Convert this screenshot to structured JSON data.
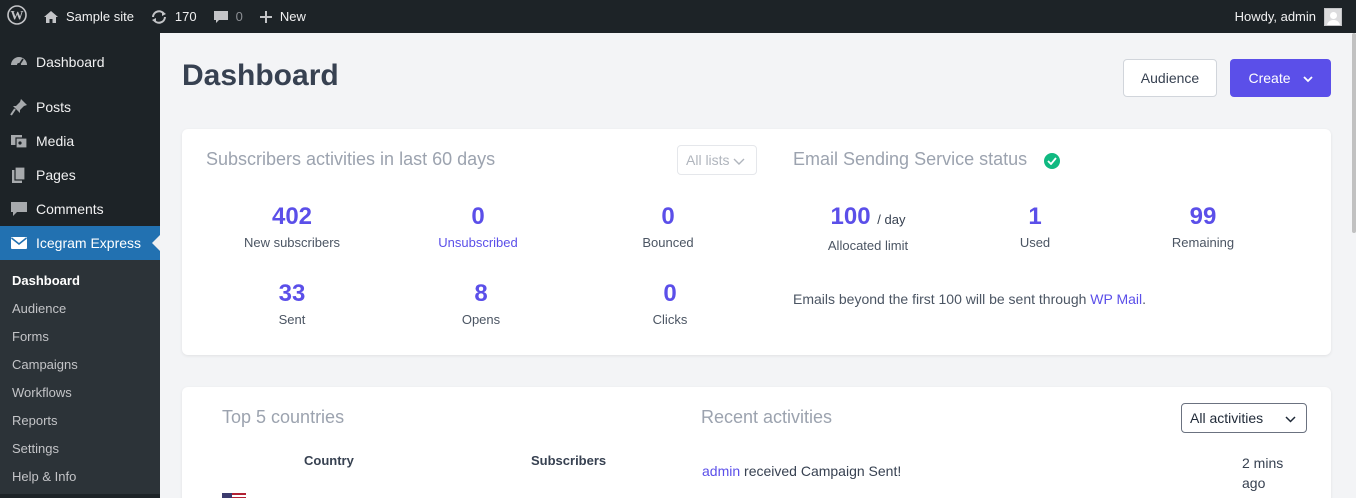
{
  "adminbar": {
    "site_name": "Sample site",
    "updates_count": "170",
    "comments_count": "0",
    "new_label": "New",
    "greeting": "Howdy, admin"
  },
  "sidebar": {
    "items": [
      {
        "label": "Dashboard",
        "icon": "dashboard-icon"
      },
      {
        "label": "Posts",
        "icon": "pin-icon"
      },
      {
        "label": "Media",
        "icon": "media-icon"
      },
      {
        "label": "Pages",
        "icon": "pages-icon"
      },
      {
        "label": "Comments",
        "icon": "comment-icon"
      },
      {
        "label": "Icegram Express",
        "icon": "email-icon"
      }
    ],
    "submenu": [
      "Dashboard",
      "Audience",
      "Forms",
      "Campaigns",
      "Workflows",
      "Reports",
      "Settings",
      "Help & Info"
    ]
  },
  "page": {
    "title": "Dashboard",
    "audience_button": "Audience",
    "create_button": "Create"
  },
  "subscribers": {
    "title": "Subscribers activities in last 60 days",
    "filter": "All lists",
    "stats": [
      {
        "value": "402",
        "label": "New subscribers"
      },
      {
        "value": "0",
        "label": "Unsubscribed"
      },
      {
        "value": "0",
        "label": "Bounced"
      },
      {
        "value": "33",
        "label": "Sent"
      },
      {
        "value": "8",
        "label": "Opens"
      },
      {
        "value": "0",
        "label": "Clicks"
      }
    ]
  },
  "sending_service": {
    "title": "Email Sending Service status",
    "allocated": {
      "value": "100",
      "unit": "/ day",
      "label": "Allocated limit"
    },
    "used": {
      "value": "1",
      "label": "Used"
    },
    "remaining": {
      "value": "99",
      "label": "Remaining"
    },
    "note_prefix": "Emails beyond the first 100 will be sent through",
    "note_link": "WP Mail",
    "note_suffix": "."
  },
  "countries": {
    "title": "Top 5 countries",
    "col_country": "Country",
    "col_subscribers": "Subscribers"
  },
  "activities": {
    "title": "Recent activities",
    "filter": "All activities",
    "items": [
      {
        "user": "admin",
        "text": "received Campaign Sent!",
        "time_1": "2 mins",
        "time_2": "ago"
      }
    ]
  },
  "colors": {
    "accent": "#5b4fe9",
    "admin_bar": "#1d2327",
    "menu_active": "#2271b1",
    "success": "#10b981"
  }
}
